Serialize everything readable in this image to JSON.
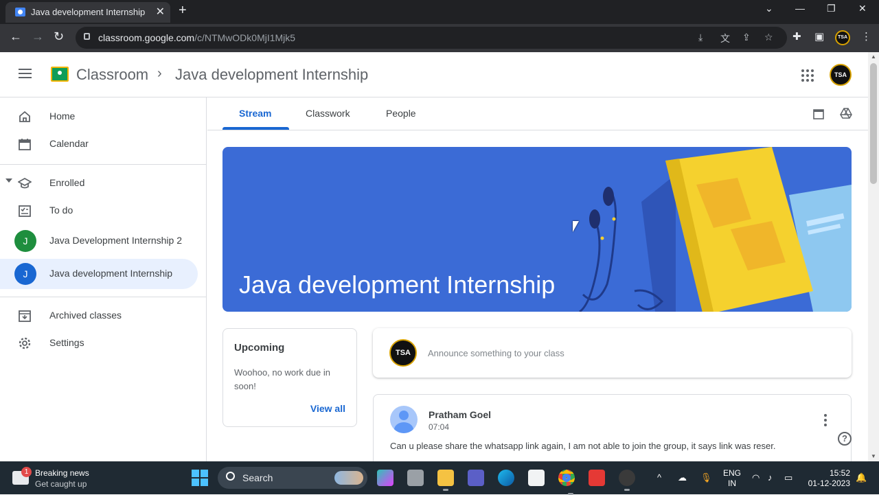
{
  "browser": {
    "tab_title": "Java development Internship",
    "url_host": "classroom.google.com",
    "url_path": "/c/NTMwODk0MjI1Mjk5"
  },
  "header": {
    "brand": "Classroom",
    "breadcrumb_sep": "›",
    "class_name": "Java development Internship"
  },
  "sidebar": {
    "items": [
      {
        "label": "Home"
      },
      {
        "label": "Calendar"
      },
      {
        "label": "Enrolled"
      },
      {
        "label": "To do"
      },
      {
        "label": "Java Development Internship 2",
        "initial": "J",
        "color": "#1e8e3e"
      },
      {
        "label": "Java development Internship",
        "initial": "J",
        "color": "#1967d2"
      },
      {
        "label": "Archived classes"
      },
      {
        "label": "Settings"
      }
    ]
  },
  "tabs": [
    {
      "label": "Stream"
    },
    {
      "label": "Classwork"
    },
    {
      "label": "People"
    }
  ],
  "banner": {
    "title": "Java development Internship",
    "color": "#3b6bd6"
  },
  "upcoming": {
    "title": "Upcoming",
    "message": "Woohoo, no work due in soon!",
    "view_all": "View all"
  },
  "announce": {
    "placeholder": "Announce something to your class"
  },
  "post": {
    "author": "Pratham Goel",
    "time": "07:04",
    "body": "Can u please share the whatsapp link again, I am not able to join the group, it says link was reser."
  },
  "avatar_text": "TSA",
  "taskbar": {
    "news_badge": "1",
    "news_title": "Breaking news",
    "news_sub": "Get caught up",
    "search": "Search",
    "lang_1": "ENG",
    "lang_2": "IN",
    "time": "15:52",
    "date": "01-12-2023"
  }
}
